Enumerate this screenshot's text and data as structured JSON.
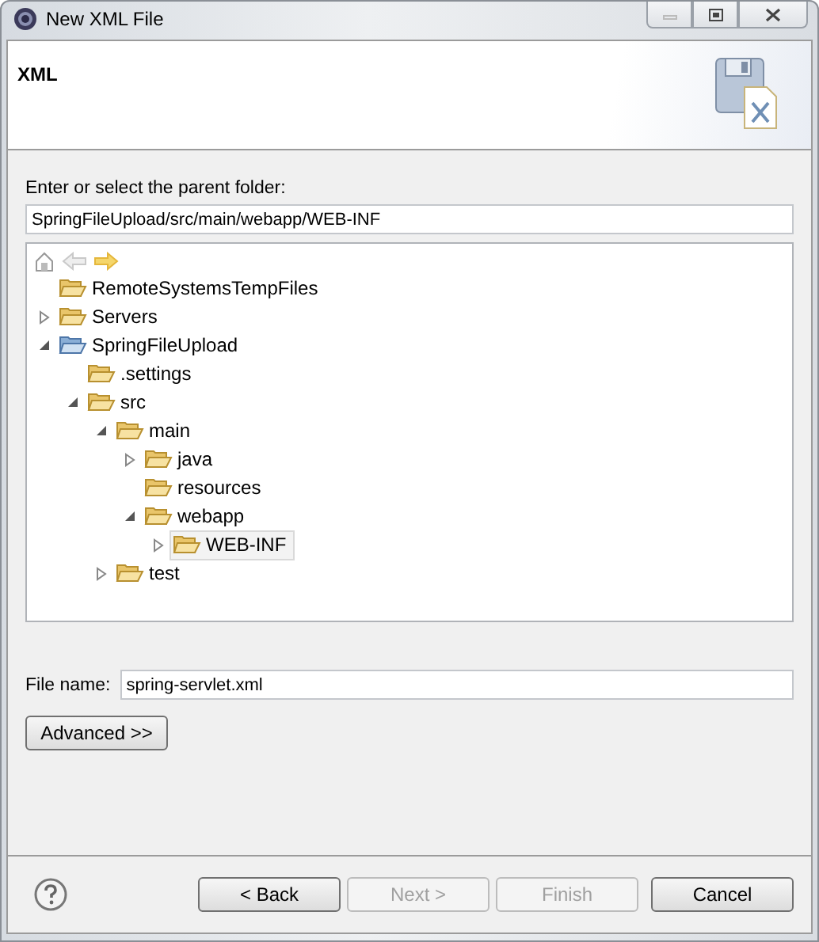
{
  "window": {
    "title": "New XML File",
    "controls": [
      {
        "kind": "minimize",
        "disabled": true
      },
      {
        "kind": "maximize",
        "disabled": false
      },
      {
        "kind": "close",
        "disabled": false
      }
    ]
  },
  "header": {
    "title": "XML"
  },
  "parent_folder": {
    "label": "Enter or select the parent folder:",
    "value": "SpringFileUpload/src/main/webapp/WEB-INF"
  },
  "tree_toolbar": [
    {
      "kind": "home",
      "disabled": false
    },
    {
      "kind": "back",
      "disabled": true
    },
    {
      "kind": "forward",
      "disabled": false
    }
  ],
  "tree": [
    {
      "label": "RemoteSystemsTempFiles",
      "kind": "folder",
      "selected": false
    },
    {
      "label": "Servers",
      "kind": "folder",
      "selected": false,
      "expanded": false
    },
    {
      "label": "SpringFileUpload",
      "kind": "project",
      "selected": false,
      "expanded": true,
      "children": [
        {
          "label": ".settings",
          "kind": "folder",
          "selected": false
        },
        {
          "label": "src",
          "kind": "folder",
          "selected": false,
          "expanded": true,
          "children": [
            {
              "label": "main",
              "kind": "folder",
              "selected": false,
              "expanded": true,
              "children": [
                {
                  "label": "java",
                  "kind": "folder",
                  "selected": false,
                  "expanded": false
                },
                {
                  "label": "resources",
                  "kind": "folder",
                  "selected": false
                },
                {
                  "label": "webapp",
                  "kind": "folder",
                  "selected": false,
                  "expanded": true,
                  "children": [
                    {
                      "label": "WEB-INF",
                      "kind": "folder",
                      "selected": true,
                      "expanded": false
                    }
                  ]
                }
              ]
            },
            {
              "label": "test",
              "kind": "folder",
              "selected": false,
              "expanded": false
            }
          ]
        }
      ]
    }
  ],
  "file_name": {
    "label": "File name:",
    "value": "spring-servlet.xml"
  },
  "advanced_button": {
    "label": "Advanced >>",
    "disabled": false
  },
  "buttons": [
    {
      "label": "< Back",
      "disabled": false
    },
    {
      "label": "Next >",
      "disabled": true
    },
    {
      "label": "Finish",
      "disabled": true
    },
    {
      "label": "Cancel",
      "disabled": false
    }
  ]
}
